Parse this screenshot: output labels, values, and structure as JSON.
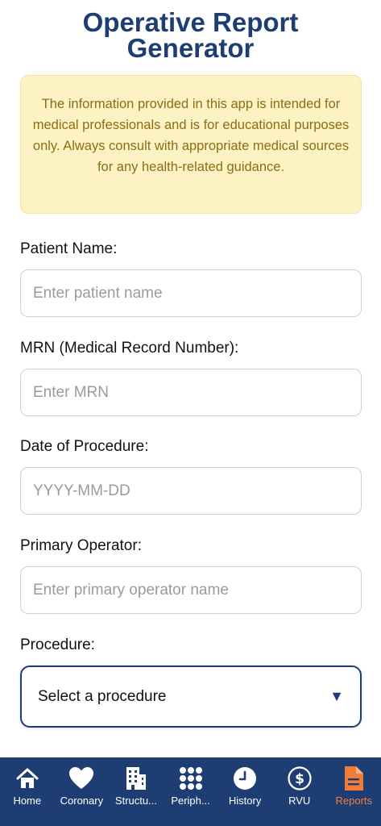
{
  "header": {
    "title_line1": "Operative Report",
    "title_line2": "Generator"
  },
  "disclaimer": {
    "text": "The information provided in this app is intended for medical professionals and is for educational purposes only. Always consult with appropriate medical sources for any health-related guidance."
  },
  "form": {
    "patient_name": {
      "label": "Patient Name:",
      "placeholder": "Enter patient name"
    },
    "mrn": {
      "label": "MRN (Medical Record Number):",
      "placeholder": "Enter MRN"
    },
    "date": {
      "label": "Date of Procedure:",
      "placeholder": "YYYY-MM-DD"
    },
    "operator": {
      "label": "Primary Operator:",
      "placeholder": "Enter primary operator name"
    },
    "procedure": {
      "label": "Procedure:",
      "selected": "Select a procedure",
      "caret": "▼"
    }
  },
  "tabs": [
    {
      "label": "Home",
      "icon": "home-icon"
    },
    {
      "label": "Coronary",
      "icon": "heart-icon"
    },
    {
      "label": "Structu...",
      "icon": "building-icon"
    },
    {
      "label": "Periph...",
      "icon": "grid-dots-icon"
    },
    {
      "label": "History",
      "icon": "clock-icon"
    },
    {
      "label": "RVU",
      "icon": "dollar-icon"
    },
    {
      "label": "Reports",
      "icon": "document-icon",
      "active": true
    }
  ],
  "colors": {
    "primary": "#1e3e73",
    "accent": "#f07d3a",
    "warning_bg": "#fdf2c4",
    "warning_text": "#8a6e12"
  }
}
